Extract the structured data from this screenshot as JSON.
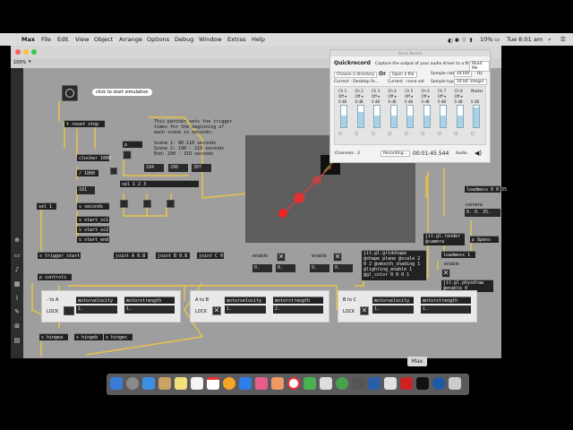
{
  "menubar": {
    "app": "Max",
    "items": [
      "File",
      "Edit",
      "View",
      "Object",
      "Arrange",
      "Options",
      "Debug",
      "Window",
      "Extras",
      "Help"
    ],
    "battery": "10%",
    "clock": "Tue 8:01 am"
  },
  "toolbar": {
    "zoom": "100%"
  },
  "colors": {
    "menubar": "#dcdcdc",
    "canvas": "#9e9e9e",
    "object": "#222222",
    "patchcord": "#e8c24a",
    "jit_bg": "#5d5d5d",
    "meter": "#a8d2ea"
  },
  "patch": {
    "bang_hint": "click to start simulation",
    "comment": "This patcher sets the trigger\ntimes for the beginning of\neach scene in seconds:\n\nScene 1: 80-110 seconds\nScene 2: 190 - 219 seconds\nEnd: 290 - 310 seconds",
    "objects": {
      "trb": "t reset stop",
      "clocker": "clocker 1000",
      "div": "/ 1000",
      "n101": "101",
      "sel1": "sel 1",
      "sel123": "sel 1 2 3",
      "n104": "104",
      "n208": "208",
      "n307": "307",
      "p": "p",
      "s_seconds": "s seconds",
      "s_start_s1": "s start_sc1",
      "s_start_s2": "s start_sc2",
      "s_start_end": "s start_end",
      "s_trigger_start": "s trigger_start",
      "joint_a": "joint A 0.8",
      "joint_b": "joint B 0.8",
      "joint_c": "joint C 0",
      "p_controls": "p controls",
      "s_hingea": "s hingea",
      "s_hingeb": "s hingeb",
      "s_hingec": "s hingec",
      "loadmess1": "loadmess 0 0 35",
      "camera": "camera",
      "camera_val": "0. 0. 35.",
      "jit_render": "jit.gl.render\n@camera",
      "p_8pens": "p 8pens",
      "loadmess2": "loadmess 1",
      "enable": "enable",
      "jit_gridshape": "jit.gl.gridshape\n@shape plane @scale 2\n0 2 @smooth_shading 1\n@lighting_enable 1\n@gl_color 0 0 0 1",
      "jit_phys": "jit.gl.physdraw\n@enable 0"
    },
    "enables": [
      {
        "label": "enable",
        "value": "0."
      },
      {
        "label": "",
        "value": "0."
      },
      {
        "label": "enable",
        "value": "0."
      },
      {
        "label": "",
        "value": "0."
      }
    ],
    "panels": [
      {
        "title": "- to A",
        "lock": "LOCK",
        "mv": "motorvelocity",
        "ms": "motorstrength",
        "v1": "1.",
        "v2": "1."
      },
      {
        "title": "A to B",
        "lock": "LOCK",
        "mv": "motorvelocity",
        "ms": "motorstrength",
        "v1": "1.",
        "v2": "2."
      },
      {
        "title": "B to C",
        "lock": "LOCK",
        "mv": "motorvelocity",
        "ms": "motorstrength",
        "v1": "1.",
        "v2": "1."
      }
    ]
  },
  "quickrecord": {
    "window_title": "Quick Record",
    "title": "Quickrecord",
    "subtitle": "Capture the output of your audio driver to a file",
    "read_me": "Read Me",
    "choose_dir": "Choose a directory",
    "or": "Or",
    "open_file": "Open a file",
    "sample_rate_label": "Sample rate",
    "sample_rate": "44100",
    "hz": "Hz",
    "current_dir": "Current : Desktop fo...",
    "current_set": "Current : none set",
    "sample_type_label": "Sample type",
    "sample_type": "16 bit integer",
    "channels": [
      {
        "name": "Ch 1",
        "state": "Off",
        "db": "0 dB",
        "level": 0.55
      },
      {
        "name": "Ch 2",
        "state": "Off",
        "db": "0 dB",
        "level": 0.7
      },
      {
        "name": "Ch 3",
        "state": "Off",
        "db": "0 dB",
        "level": 0.55
      },
      {
        "name": "Ch 4",
        "state": "Off",
        "db": "0 dB",
        "level": 0.55
      },
      {
        "name": "Ch 5",
        "state": "Off",
        "db": "0 dB",
        "level": 0.55
      },
      {
        "name": "Ch 6",
        "state": "Off",
        "db": "0 dB",
        "level": 0.55
      },
      {
        "name": "Ch 7",
        "state": "Off",
        "db": "0 dB",
        "level": 0.55
      },
      {
        "name": "Ch 8",
        "state": "Off",
        "db": "0 dB",
        "level": 0.55
      }
    ],
    "master": {
      "name": "Master",
      "db": "0 dB",
      "level": 0.9
    },
    "channels_label": "Channels : 2",
    "recording": "Recording...",
    "time": "00:01:45.544",
    "audio": "Audio"
  },
  "dock": {
    "tooltip": "Max"
  }
}
